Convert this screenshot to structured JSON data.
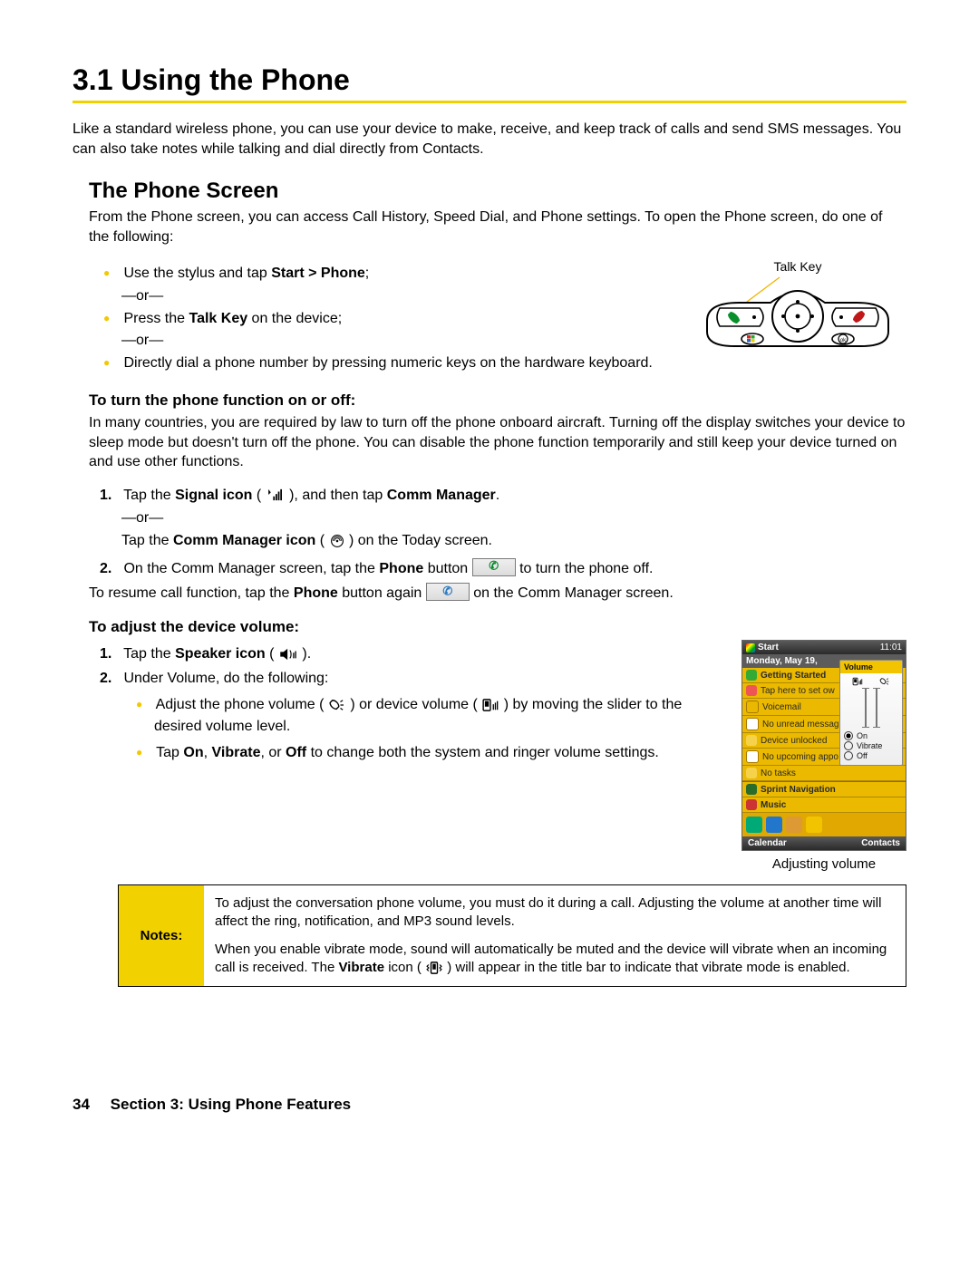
{
  "h1": "3.1  Using the Phone",
  "intro": "Like a standard wireless phone, you can use your device to make, receive, and keep track of calls and send SMS messages. You can also take notes while talking and dial directly from Contacts.",
  "h2": "The Phone Screen",
  "phoneScreen": {
    "lead": "From the Phone screen, you can access Call History, Speed Dial, and Phone settings. To open the Phone screen, do one of the following:",
    "items": [
      {
        "pre": "Use the stylus and tap ",
        "bold": "Start > Phone",
        "post": ";"
      },
      {
        "pre": "Press the ",
        "bold": "Talk Key",
        "post": " on the device;"
      },
      {
        "pre": "Directly dial a phone number by pressing numeric keys on the hardware keyboard.",
        "bold": "",
        "post": ""
      }
    ],
    "or": "—or—",
    "figLabel": "Talk Key"
  },
  "turnTitle": "To turn the phone function on or off:",
  "turn": {
    "lead": "In many countries, you are required by law to turn off the phone onboard aircraft. Turning off the display switches your device to sleep mode but doesn't turn off the phone. You can disable the phone function temporarily and still keep your device turned on and use other functions.",
    "step1_a": "Tap the ",
    "step1_b": "Signal icon",
    "step1_c": " ( ",
    "step1_d": " ), and then tap ",
    "step1_e": "Comm Manager",
    "step1_f": ".",
    "or": "—or—",
    "alt_a": "Tap the ",
    "alt_b": "Comm Manager icon",
    "alt_c": " ( ",
    "alt_d": " ) on the Today screen.",
    "step2_a": "On the Comm Manager screen, tap the ",
    "step2_b": "Phone",
    "step2_c": " button ",
    "step2_d": " to turn the phone off.",
    "resume_a": "To resume call function, tap the ",
    "resume_b": "Phone",
    "resume_c": " button again ",
    "resume_d": " on the Comm Manager screen."
  },
  "volTitle": "To adjust the device volume:",
  "vol": {
    "s1_a": "Tap the ",
    "s1_b": "Speaker icon",
    "s1_c": " ( ",
    "s1_d": " ).",
    "s2": "Under Volume, do the following:",
    "b1_a": "Adjust the phone volume ( ",
    "b1_b": " ) or device volume ( ",
    "b1_c": " ) by moving the slider to the desired volume level.",
    "b2_a": "Tap ",
    "b2_on": "On",
    "b2_sep1": ", ",
    "b2_vib": "Vibrate",
    "b2_sep2": ", or ",
    "b2_off": "Off",
    "b2_b": " to change both the system and ringer volume settings.",
    "caption": "Adjusting volume"
  },
  "device": {
    "start": "Start",
    "time": "11:01",
    "date": "Monday, May 19,",
    "getting": "Getting Started",
    "owner": "Tap here to set ow",
    "vm": "Voicemail",
    "msg": "No unread messag",
    "unlock": "Device unlocked",
    "appt": "No upcoming appo",
    "tasks": "No tasks",
    "nav": "Sprint Navigation",
    "music": "Music",
    "cal": "Calendar",
    "contacts": "Contacts",
    "volHdr": "Volume",
    "optOn": "On",
    "optVib": "Vibrate",
    "optOff": "Off"
  },
  "notes": {
    "label": "Notes:",
    "p1": "To adjust the conversation phone volume, you must do it during a call. Adjusting the volume at another time will affect the ring, notification, and MP3 sound levels.",
    "p2a": "When you enable vibrate mode, sound will automatically be muted and the device will vibrate when an incoming call is received. The ",
    "p2b": "Vibrate",
    "p2c": " icon ( ",
    "p2d": " ) will appear in the title bar to indicate that vibrate mode is enabled."
  },
  "footer": {
    "page": "34",
    "section": "Section 3: Using Phone Features"
  }
}
